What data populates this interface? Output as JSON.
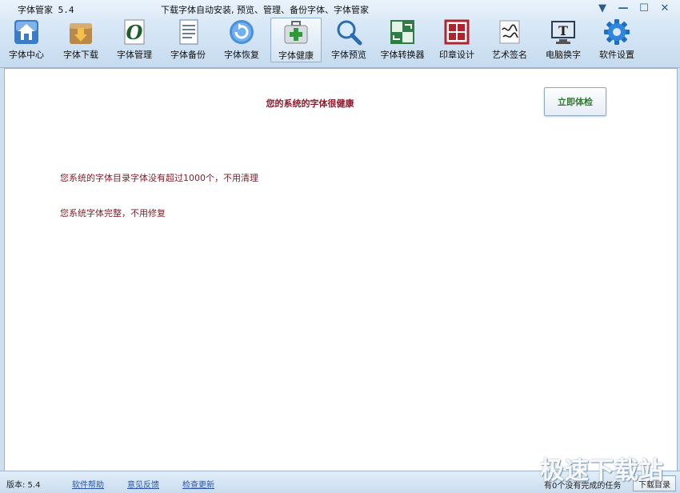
{
  "app": {
    "title": "字体管家 5.4",
    "slogan": "下载字体自动安装, 预览、管理、备份字体、字体管家"
  },
  "window_controls": {
    "menu_glyph": "▼",
    "minimize_glyph": "—",
    "maximize_glyph": "☐",
    "close_glyph": "✕"
  },
  "toolbar": {
    "active": "字体健康",
    "items": [
      {
        "label": "字体中心",
        "icon": "house-icon"
      },
      {
        "label": "字体下载",
        "icon": "download-box-icon"
      },
      {
        "label": "字体管理",
        "icon": "font-o-icon"
      },
      {
        "label": "字体备份",
        "icon": "document-icon"
      },
      {
        "label": "字体恢复",
        "icon": "restore-icon"
      },
      {
        "label": "字体健康",
        "icon": "medical-kit-icon"
      },
      {
        "label": "字体预览",
        "icon": "magnifier-icon"
      },
      {
        "label": "字体转换器",
        "icon": "convert-icon"
      },
      {
        "label": "印章设计",
        "icon": "seal-icon"
      },
      {
        "label": "艺术签名",
        "icon": "signature-icon"
      },
      {
        "label": "电脑换字",
        "icon": "monitor-t-icon"
      },
      {
        "label": "软件设置",
        "icon": "gear-icon"
      }
    ]
  },
  "main": {
    "health_status": "您的系统的字体很健康",
    "check_button": "立即体检",
    "messages": [
      "您系统的字体目录字体没有超过1000个，不用清理",
      "您系统字体完整，不用修复"
    ]
  },
  "statusbar": {
    "version": "版本: 5.4",
    "links": [
      "软件帮助",
      "意见反馈",
      "检查更新"
    ],
    "tasks": "有0个没有完成的任务",
    "download_dir_button": "下载目录"
  },
  "watermark": "极速下载站",
  "colors": {
    "accent_red": "#8b1a2b",
    "check_green": "#2f7a2f",
    "link_blue": "#2b55a6",
    "chrome_blue": "#c6dbef"
  }
}
